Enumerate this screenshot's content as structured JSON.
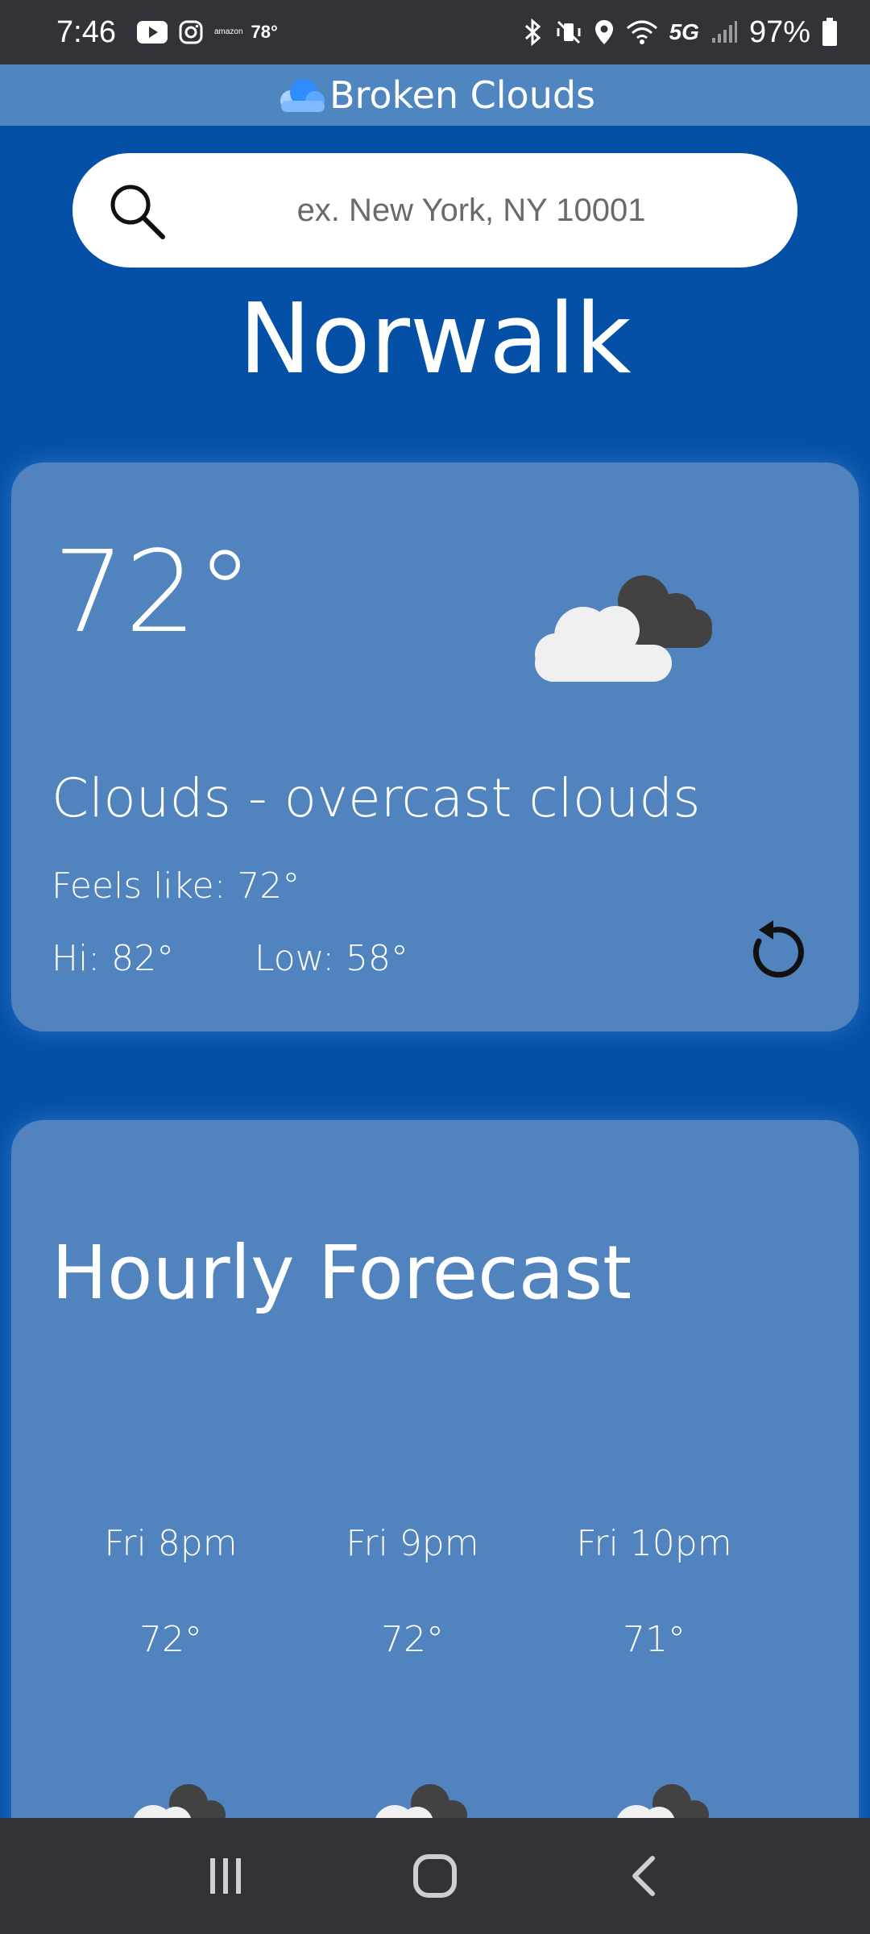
{
  "status_bar": {
    "time": "7:46",
    "weather_temp": "78°",
    "amazon_label": "amazon",
    "network": "5G",
    "battery": "97%"
  },
  "app": {
    "title": "Broken Clouds"
  },
  "search": {
    "placeholder": "ex. New York, NY 10001",
    "value": ""
  },
  "location": {
    "city": "Norwalk"
  },
  "current": {
    "temperature": "72°",
    "description": "Clouds - overcast clouds",
    "feels_like": "Feels like: 72°",
    "hi": "Hi: 82°",
    "low": "Low: 58°",
    "icon": "broken-clouds-icon"
  },
  "hourly": {
    "title": "Hourly Forecast",
    "items": [
      {
        "time": "Fri 8pm",
        "temp": "72°",
        "icon": "broken-clouds-icon"
      },
      {
        "time": "Fri 9pm",
        "temp": "72°",
        "icon": "broken-clouds-icon"
      },
      {
        "time": "Fri 10pm",
        "temp": "71°",
        "icon": "broken-clouds-icon"
      }
    ]
  },
  "colors": {
    "background": "#0450a6",
    "card": "#5184be",
    "header": "#4f86bf",
    "system_bars": "#313338"
  }
}
